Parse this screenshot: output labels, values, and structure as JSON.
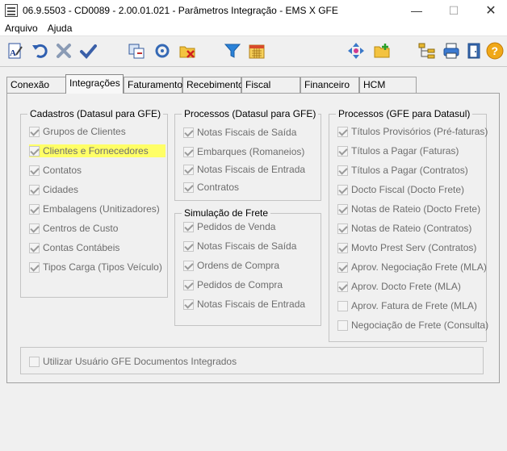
{
  "window": {
    "title": "06.9.5503 - CD0089 - 2.00.01.021 - Parâmetros Integração - EMS X GFE",
    "minimize": "—",
    "maximize": "☐",
    "close": "✕"
  },
  "menu": [
    {
      "label": "Arquivo"
    },
    {
      "label": "Ajuda"
    }
  ],
  "toolbar": {
    "buttons": [
      "edit-doc",
      "undo",
      "cancel",
      "confirm",
      "copy-window",
      "sync",
      "clear-folder",
      "filter",
      "calendar",
      "move",
      "new-folder",
      "tree",
      "print",
      "exit",
      "help"
    ],
    "help_label": "?"
  },
  "tabs": [
    {
      "label": "Conexão"
    },
    {
      "label": "Integrações",
      "active": true
    },
    {
      "label": "Faturamento"
    },
    {
      "label": "Recebimento"
    },
    {
      "label": "Fiscal"
    },
    {
      "label": "Financeiro"
    },
    {
      "label": "HCM"
    }
  ],
  "groups": {
    "cadastros": {
      "title": "Cadastros (Datasul para GFE)",
      "items": [
        {
          "label": "Grupos de Clientes",
          "checked": true
        },
        {
          "label": "Clientes e Fornecedores",
          "checked": true,
          "highlighted": true
        },
        {
          "label": "Contatos",
          "checked": true
        },
        {
          "label": "Cidades",
          "checked": true
        },
        {
          "label": "Embalagens (Unitizadores)",
          "checked": true
        },
        {
          "label": "Centros de Custo",
          "checked": true
        },
        {
          "label": "Contas Contábeis",
          "checked": true
        },
        {
          "label": "Tipos Carga (Tipos Veículo)",
          "checked": true
        }
      ]
    },
    "processos_datasul": {
      "title": "Processos (Datasul para GFE)",
      "items": [
        {
          "label": "Notas Fiscais de Saída",
          "checked": true
        },
        {
          "label": "Embarques (Romaneios)",
          "checked": true
        },
        {
          "label": "Notas Fiscais de Entrada",
          "checked": true
        },
        {
          "label": "Contratos",
          "checked": true
        }
      ]
    },
    "simulacao": {
      "title": "Simulação de Frete",
      "items": [
        {
          "label": "Pedidos de Venda",
          "checked": true
        },
        {
          "label": "Notas Fiscais de Saída",
          "checked": true
        },
        {
          "label": "Ordens de Compra",
          "checked": true
        },
        {
          "label": "Pedidos de Compra",
          "checked": true
        },
        {
          "label": "Notas Fiscais de Entrada",
          "checked": true
        }
      ]
    },
    "processos_gfe": {
      "title": "Processos (GFE para Datasul)",
      "items": [
        {
          "label": "Títulos Provisórios (Pré-faturas)",
          "checked": true
        },
        {
          "label": "Títulos a Pagar (Faturas)",
          "checked": true
        },
        {
          "label": "Títulos a Pagar (Contratos)",
          "checked": true
        },
        {
          "label": "Docto Fiscal (Docto Frete)",
          "checked": true
        },
        {
          "label": "Notas de Rateio (Docto Frete)",
          "checked": true
        },
        {
          "label": "Notas de Rateio (Contratos)",
          "checked": true
        },
        {
          "label": "Movto Prest Serv (Contratos)",
          "checked": true
        },
        {
          "label": "Aprov. Negociação Frete (MLA)",
          "checked": true
        },
        {
          "label": "Aprov. Docto Frete (MLA)",
          "checked": true
        },
        {
          "label": "Aprov. Fatura de Frete (MLA)",
          "checked": false
        },
        {
          "label": "Negociação de Frete (Consulta)",
          "checked": false
        }
      ]
    },
    "usuario": {
      "label": "Utilizar Usuário GFE Documentos Integrados",
      "checked": false
    }
  },
  "colors": {
    "highlight": "#ffff66",
    "disabled_text": "#6d6d6d",
    "window_bg": "#f0f0f0"
  }
}
